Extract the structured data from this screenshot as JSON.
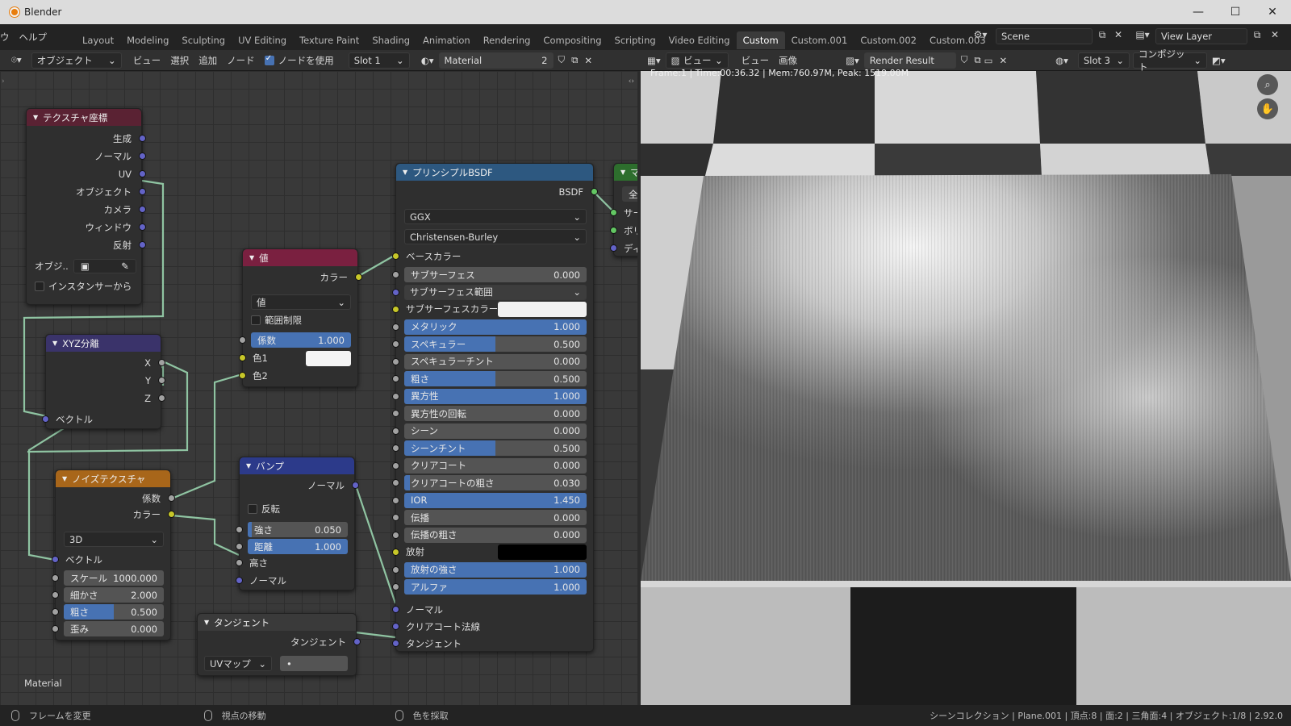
{
  "window": {
    "title": "Blender",
    "min": "—",
    "max": "☐",
    "close": "✕"
  },
  "menu": {
    "items": [
      "ウ",
      "ヘルプ"
    ]
  },
  "workspaces": [
    "Layout",
    "Modeling",
    "Sculpting",
    "UV Editing",
    "Texture Paint",
    "Shading",
    "Animation",
    "Rendering",
    "Compositing",
    "Scripting",
    "Video Editing",
    "Custom",
    "Custom.001",
    "Custom.002",
    "Custom.003"
  ],
  "active_workspace": "Custom",
  "scene": {
    "name": "Scene",
    "view_layer": "View Layer"
  },
  "node_header": {
    "mode": "オブジェクト",
    "menus": [
      "ビュー",
      "選択",
      "追加",
      "ノード"
    ],
    "use_nodes": "ノードを使用",
    "slot": "Slot 1",
    "material": "Material",
    "users": "2"
  },
  "image_header": {
    "view": "ビュー",
    "menus": [
      "ビュー",
      "画像"
    ],
    "image": "Render Result",
    "slot": "Slot 3",
    "pass": "コンポジット"
  },
  "frame_info": "Frame:1 | Time:00:36.32 | Mem:760.97M, Peak: 1519.00M",
  "editor_label": "Material",
  "nodes": {
    "texcoord": {
      "title": "テクスチャ座標",
      "outputs": [
        "生成",
        "ノーマル",
        "UV",
        "オブジェクト",
        "カメラ",
        "ウィンドウ",
        "反射"
      ],
      "object_label": "オブジ..",
      "from_instancer": "インスタンサーから"
    },
    "xyz": {
      "title": "XYZ分離",
      "outputs": [
        "X",
        "Y",
        "Z"
      ],
      "input": "ベクトル"
    },
    "noise": {
      "title": "ノイズテクスチャ",
      "outputs": [
        "係数",
        "カラー"
      ],
      "dim": "3D",
      "vector": "ベクトル",
      "fields": [
        {
          "label": "スケール",
          "value": "1000.000",
          "fill": 0
        },
        {
          "label": "細かさ",
          "value": "2.000",
          "fill": 0
        },
        {
          "label": "粗さ",
          "value": "0.500",
          "fill": 0.5
        },
        {
          "label": "歪み",
          "value": "0.000",
          "fill": 0
        }
      ]
    },
    "value": {
      "title": "値",
      "output": "カラー",
      "blend": "値",
      "clamp": "範囲制限",
      "factor_label": "係数",
      "factor": "1.000",
      "color1": "色1",
      "color2": "色2"
    },
    "bump": {
      "title": "バンプ",
      "output": "ノーマル",
      "invert": "反転",
      "strength_label": "強さ",
      "strength": "0.050",
      "distance_label": "距離",
      "distance": "1.000",
      "height": "高さ",
      "normal": "ノーマル"
    },
    "tangent": {
      "title": "タンジェント",
      "output": "タンジェント",
      "mode": "UVマップ",
      "map": "•"
    },
    "bsdf": {
      "title": "プリンシプルBSDF",
      "output": "BSDF",
      "distribution": "GGX",
      "subsurface_method": "Christensen-Burley",
      "base_color": "ベースカラー",
      "fields": [
        {
          "label": "サブサーフェス",
          "value": "0.000",
          "fill": 0
        },
        {
          "label": "サブサーフェス範囲",
          "value": "",
          "fill": 0,
          "select": true
        },
        {
          "label": "サブサーフェスカラー",
          "value": "",
          "fill": 0,
          "color": "#f0f0f0"
        },
        {
          "label": "メタリック",
          "value": "1.000",
          "fill": 1
        },
        {
          "label": "スペキュラー",
          "value": "0.500",
          "fill": 0.5
        },
        {
          "label": "スペキュラーチント",
          "value": "0.000",
          "fill": 0
        },
        {
          "label": "粗さ",
          "value": "0.500",
          "fill": 0.5
        },
        {
          "label": "異方性",
          "value": "1.000",
          "fill": 1
        },
        {
          "label": "異方性の回転",
          "value": "0.000",
          "fill": 0
        },
        {
          "label": "シーン",
          "value": "0.000",
          "fill": 0
        },
        {
          "label": "シーンチント",
          "value": "0.500",
          "fill": 0.5
        },
        {
          "label": "クリアコート",
          "value": "0.000",
          "fill": 0
        },
        {
          "label": "クリアコートの粗さ",
          "value": "0.030",
          "fill": 0.03
        },
        {
          "label": "IOR",
          "value": "1.450",
          "fill": 1
        },
        {
          "label": "伝播",
          "value": "0.000",
          "fill": 0
        },
        {
          "label": "伝播の粗さ",
          "value": "0.000",
          "fill": 0
        },
        {
          "label": "放射",
          "value": "",
          "fill": 0,
          "color": "#000000"
        },
        {
          "label": "放射の強さ",
          "value": "1.000",
          "fill": 1
        },
        {
          "label": "アルファ",
          "value": "1.000",
          "fill": 1
        }
      ],
      "inputs": [
        "ノーマル",
        "クリアコート法線",
        "タンジェント"
      ]
    },
    "output": {
      "title": "マ",
      "target": "全",
      "inputs": [
        "サー",
        "ボリ",
        "ディ"
      ]
    }
  },
  "status": {
    "left": "フレームを変更",
    "mid": "視点の移動",
    "right": "色を採取",
    "info": "シーンコレクション | Plane.001 | 頂点:8 | 面:2 | 三角面:4 | オブジェクト:1/8 | 2.92.0"
  },
  "colors": {
    "header_texcoord": "#a73b5d",
    "header_vector": "#433975",
    "header_texture": "#c9801e",
    "header_input": "#8b2346",
    "header_bump": "#2f3f8c",
    "header_shader": "#2a5a88",
    "header_output": "#2a6a2a",
    "accent": "#4772b3"
  }
}
